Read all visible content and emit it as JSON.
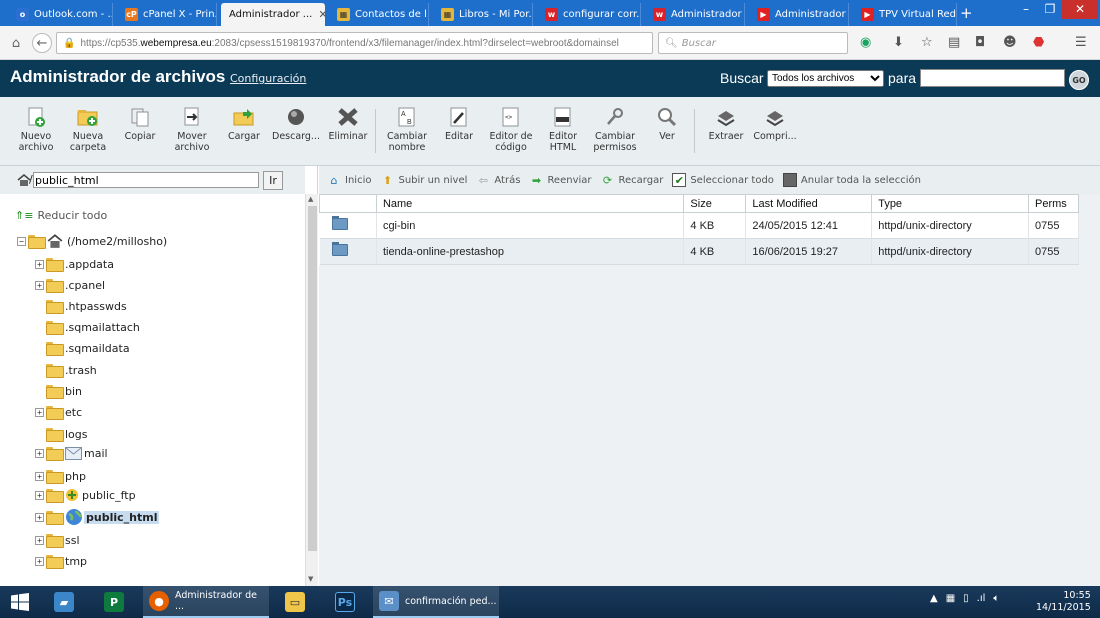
{
  "browser": {
    "tabs": [
      {
        "label": "Outlook.com - ...",
        "icon": "outlook-icon",
        "color": "#2a6fd1"
      },
      {
        "label": "cPanel X - Prin...",
        "icon": "cpanel-icon",
        "color": "#e8781e"
      },
      {
        "label": "Administrador ...",
        "icon": "none",
        "color": "#f4f4f4",
        "active": true
      },
      {
        "label": "Contactos de l...",
        "icon": "calendar-icon",
        "color": "#e4b63a"
      },
      {
        "label": "Libros - Mi Por...",
        "icon": "calendar-icon",
        "color": "#e4b63a"
      },
      {
        "label": "configurar corr...",
        "icon": "webempresa-icon",
        "color": "#d9232a"
      },
      {
        "label": "Administrador ...",
        "icon": "webempresa-icon",
        "color": "#d9232a"
      },
      {
        "label": "Administrador ...",
        "icon": "youtube-icon",
        "color": "#e02121"
      },
      {
        "label": "TPV Virtual Red...",
        "icon": "youtube-icon",
        "color": "#e02121"
      }
    ],
    "url_prefix": "https://cp535.",
    "url_host": "webempresa.eu",
    "url_rest": ":2083/cpsess1519819370/frontend/x3/filemanager/index.html?dirselect=webroot&domainsel",
    "search_placeholder": "Buscar"
  },
  "cpanel": {
    "title": "Administrador de archivos",
    "config_link": "Configuración",
    "search_label": "Buscar",
    "search_scope": "Todos los archivos",
    "para_label": "para",
    "go_label": "GO"
  },
  "toolbar": [
    {
      "label1": "Nuevo",
      "label2": "archivo",
      "icon": "new-file-icon"
    },
    {
      "label1": "Nueva",
      "label2": "carpeta",
      "icon": "new-folder-icon"
    },
    {
      "label1": "Copiar",
      "label2": "",
      "icon": "copy-icon"
    },
    {
      "label1": "Mover",
      "label2": "archivo",
      "icon": "move-icon"
    },
    {
      "label1": "Cargar",
      "label2": "",
      "icon": "upload-icon"
    },
    {
      "label1": "Descarg...",
      "label2": "",
      "icon": "download-icon"
    },
    {
      "label1": "Eliminar",
      "label2": "",
      "icon": "delete-icon"
    },
    {
      "label1": "Cambiar",
      "label2": "nombre",
      "icon": "rename-icon"
    },
    {
      "label1": "Editar",
      "label2": "",
      "icon": "edit-icon"
    },
    {
      "label1": "Editor de",
      "label2": "código",
      "icon": "code-editor-icon"
    },
    {
      "label1": "Editor",
      "label2": "HTML",
      "icon": "html-editor-icon"
    },
    {
      "label1": "Cambiar",
      "label2": "permisos",
      "icon": "permissions-icon"
    },
    {
      "label1": "Ver",
      "label2": "",
      "icon": "view-icon"
    },
    {
      "label1": "Extraer",
      "label2": "",
      "icon": "extract-icon"
    },
    {
      "label1": "Compri...",
      "label2": "",
      "icon": "compress-icon"
    }
  ],
  "left": {
    "path_value": "public_html",
    "go_button": "Ir",
    "collapse_all": "Reducir todo",
    "root": "(/home2/millosho)",
    "tree": [
      {
        "name": ".appdata",
        "expandable": true
      },
      {
        "name": ".cpanel",
        "expandable": true
      },
      {
        "name": ".htpasswds",
        "expandable": false
      },
      {
        "name": ".sqmailattach",
        "expandable": false
      },
      {
        "name": ".sqmaildata",
        "expandable": false
      },
      {
        "name": ".trash",
        "expandable": false
      },
      {
        "name": "bin",
        "expandable": false
      },
      {
        "name": "etc",
        "expandable": true
      },
      {
        "name": "logs",
        "expandable": false
      },
      {
        "name": "mail",
        "expandable": true,
        "icon": "mail-icon"
      },
      {
        "name": "php",
        "expandable": true
      },
      {
        "name": "public_ftp",
        "expandable": true,
        "icon": "ftp-icon"
      },
      {
        "name": "public_html",
        "expandable": true,
        "icon": "globe-icon",
        "selected": true
      },
      {
        "name": "ssl",
        "expandable": true
      },
      {
        "name": "tmp",
        "expandable": true
      }
    ]
  },
  "right": {
    "nav": {
      "home": "Inicio",
      "up": "Subir un nivel",
      "back": "Atrás",
      "forward": "Reenviar",
      "reload": "Recargar",
      "select_all": "Seleccionar todo",
      "deselect_all": "Anular toda la selección"
    },
    "columns": [
      "Name",
      "Size",
      "Last Modified",
      "Type",
      "Perms"
    ],
    "rows": [
      {
        "name": "cgi-bin",
        "size": "4 KB",
        "modified": "24/05/2015 12:41",
        "type": "httpd/unix-directory",
        "perms": "0755"
      },
      {
        "name": "tienda-online-prestashop",
        "size": "4 KB",
        "modified": "16/06/2015 19:27",
        "type": "httpd/unix-directory",
        "perms": "0755"
      }
    ]
  },
  "taskbar": {
    "apps": [
      {
        "label": "Administrador de ...",
        "icon": "firefox-icon",
        "running": true
      },
      {
        "label": "confirmación ped...",
        "icon": "mail-app-icon",
        "running": true
      }
    ],
    "clock_time": "10:55",
    "clock_date": "14/11/2015"
  }
}
